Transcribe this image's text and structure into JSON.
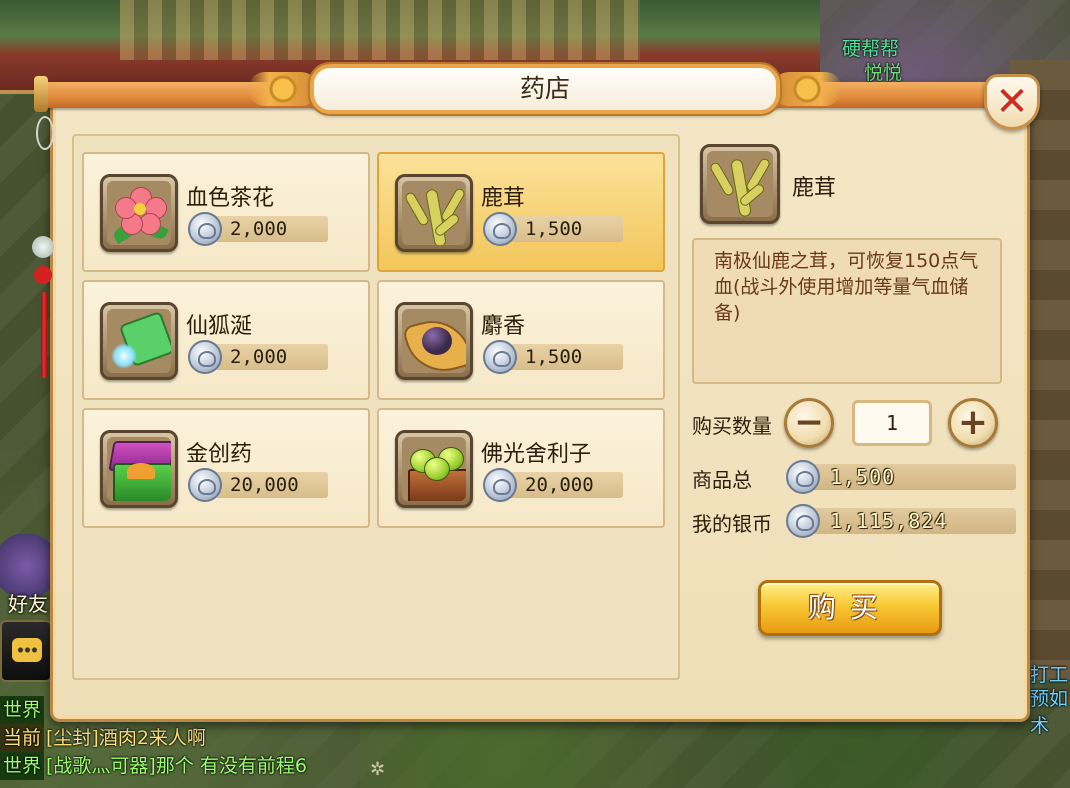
{
  "world": {
    "npc_names": [
      "硬帮帮",
      "悦悦",
      "打工",
      "预如术"
    ],
    "friend_label": "好友"
  },
  "shop": {
    "title": "药店",
    "items": [
      {
        "name": "血色茶花",
        "price": "2,000",
        "icon": "camellia-icon",
        "selected": false
      },
      {
        "name": "鹿茸",
        "price": "1,500",
        "icon": "antler-icon",
        "selected": true
      },
      {
        "name": "仙狐涎",
        "price": "2,000",
        "icon": "fox-saliva-icon",
        "selected": false
      },
      {
        "name": "麝香",
        "price": "1,500",
        "icon": "musk-icon",
        "selected": false
      },
      {
        "name": "金创药",
        "price": "20,000",
        "icon": "medicine-box-icon",
        "selected": false
      },
      {
        "name": "佛光舍利子",
        "price": "20,000",
        "icon": "relic-beads-icon",
        "selected": false
      }
    ],
    "detail": {
      "name": "鹿茸",
      "description": "南极仙鹿之茸，可恢复150点气血(战斗外使用增加等量气血储备)"
    },
    "quantity_label": "购买数量",
    "quantity": "1",
    "total_label": "商品总",
    "total_value": "1,500",
    "silver_label": "我的银币",
    "silver_value": "1,115,824",
    "buy_label": "购买"
  },
  "chat": [
    {
      "channel": "世界",
      "text": ""
    },
    {
      "channel": "当前",
      "text": "[尘封]酒肉2来人啊"
    },
    {
      "channel": "世界",
      "text": "[战歌灬可器]那个   有没有前程6"
    }
  ],
  "colors": {
    "accent": "#e08a3a",
    "selected_item": "#f3c65a",
    "buy_button": "#f8c834",
    "close_x": "#d42a1a"
  }
}
